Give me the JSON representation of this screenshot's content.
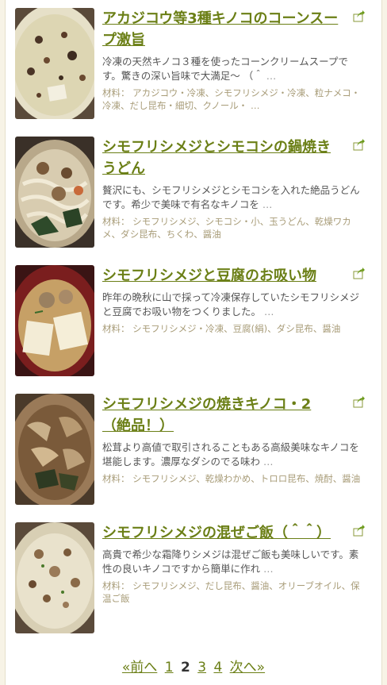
{
  "recipes": [
    {
      "title": "アカジコウ等3種キノコのコーンスープ激旨",
      "description": "冷凍の天然キノコ３種を使ったコーンクリームスープです。驚きの深い旨味で大満足～ （＾",
      "more": "…",
      "ingredients": "材料： アカジコウ・冷凍、シモフリシメジ・冷凍、粒ナメコ・冷凍、だし昆布・細切、クノール・",
      "ingredients_more": "…",
      "image": "corn-soup-photo"
    },
    {
      "title": "シモフリシメジとシモコシの鍋焼きうどん",
      "description": "贅沢にも、シモフリシメジとシモコシを入れた絶品うどんです。希少で美味で有名なキノコを",
      "more": "…",
      "ingredients": "材料： シモフリシメジ、シモコシ・小、玉うどん、乾燥ワカメ、ダシ昆布、ちくわ、醤油",
      "ingredients_more": "",
      "image": "nabeyaki-udon-photo"
    },
    {
      "title": "シモフリシメジと豆腐のお吸い物",
      "description": "昨年の晩秋に山で採って冷凍保存していたシモフリシメジと豆腐でお吸い物をつくりました。",
      "more": "…",
      "ingredients": "材料： シモフリシメジ・冷凍、豆腐(絹)、ダシ昆布、醤油",
      "ingredients_more": "",
      "image": "osuimono-photo"
    },
    {
      "title": "シモフリシメジの焼きキノコ・2（絶品！）",
      "description": "松茸より高値で取引されることもある高級美味なキノコを堪能します。濃厚なダシのでる味わ",
      "more": "…",
      "ingredients": "材料： シモフリシメジ、乾燥わかめ、トロロ昆布、焼酎、醤油",
      "ingredients_more": "",
      "image": "yaki-kinoko-photo"
    },
    {
      "title": "シモフリシメジの混ぜご飯（＾＾）",
      "description": "高貴で希少な霜降りシメジは混ぜご飯も美味しいです。素性の良いキノコですから簡単に作れ",
      "more": "…",
      "ingredients": "材料： シモフリシメジ、だし昆布、醤油、オリーブオイル、保温ご飯",
      "ingredients_more": "",
      "image": "mazegohan-photo"
    }
  ],
  "pagination": {
    "prev": "«前へ",
    "pages": [
      "1",
      "2",
      "3",
      "4"
    ],
    "current": "2",
    "next": "次へ»"
  },
  "colors": {
    "title": "#6b7f16",
    "ingredients": "#a89c78",
    "background": "#f7f3e6"
  },
  "icons": {
    "share": "share-arrow-icon"
  }
}
